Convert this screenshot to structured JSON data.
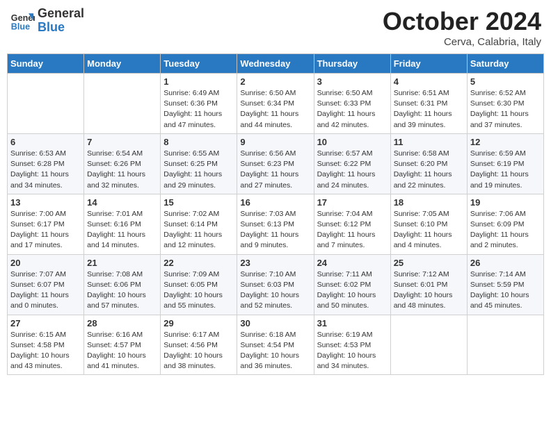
{
  "header": {
    "logo_line1": "General",
    "logo_line2": "Blue",
    "month_title": "October 2024",
    "location": "Cerva, Calabria, Italy"
  },
  "days_of_week": [
    "Sunday",
    "Monday",
    "Tuesday",
    "Wednesday",
    "Thursday",
    "Friday",
    "Saturday"
  ],
  "weeks": [
    [
      {
        "day": "",
        "info": ""
      },
      {
        "day": "",
        "info": ""
      },
      {
        "day": "1",
        "info": "Sunrise: 6:49 AM\nSunset: 6:36 PM\nDaylight: 11 hours and 47 minutes."
      },
      {
        "day": "2",
        "info": "Sunrise: 6:50 AM\nSunset: 6:34 PM\nDaylight: 11 hours and 44 minutes."
      },
      {
        "day": "3",
        "info": "Sunrise: 6:50 AM\nSunset: 6:33 PM\nDaylight: 11 hours and 42 minutes."
      },
      {
        "day": "4",
        "info": "Sunrise: 6:51 AM\nSunset: 6:31 PM\nDaylight: 11 hours and 39 minutes."
      },
      {
        "day": "5",
        "info": "Sunrise: 6:52 AM\nSunset: 6:30 PM\nDaylight: 11 hours and 37 minutes."
      }
    ],
    [
      {
        "day": "6",
        "info": "Sunrise: 6:53 AM\nSunset: 6:28 PM\nDaylight: 11 hours and 34 minutes."
      },
      {
        "day": "7",
        "info": "Sunrise: 6:54 AM\nSunset: 6:26 PM\nDaylight: 11 hours and 32 minutes."
      },
      {
        "day": "8",
        "info": "Sunrise: 6:55 AM\nSunset: 6:25 PM\nDaylight: 11 hours and 29 minutes."
      },
      {
        "day": "9",
        "info": "Sunrise: 6:56 AM\nSunset: 6:23 PM\nDaylight: 11 hours and 27 minutes."
      },
      {
        "day": "10",
        "info": "Sunrise: 6:57 AM\nSunset: 6:22 PM\nDaylight: 11 hours and 24 minutes."
      },
      {
        "day": "11",
        "info": "Sunrise: 6:58 AM\nSunset: 6:20 PM\nDaylight: 11 hours and 22 minutes."
      },
      {
        "day": "12",
        "info": "Sunrise: 6:59 AM\nSunset: 6:19 PM\nDaylight: 11 hours and 19 minutes."
      }
    ],
    [
      {
        "day": "13",
        "info": "Sunrise: 7:00 AM\nSunset: 6:17 PM\nDaylight: 11 hours and 17 minutes."
      },
      {
        "day": "14",
        "info": "Sunrise: 7:01 AM\nSunset: 6:16 PM\nDaylight: 11 hours and 14 minutes."
      },
      {
        "day": "15",
        "info": "Sunrise: 7:02 AM\nSunset: 6:14 PM\nDaylight: 11 hours and 12 minutes."
      },
      {
        "day": "16",
        "info": "Sunrise: 7:03 AM\nSunset: 6:13 PM\nDaylight: 11 hours and 9 minutes."
      },
      {
        "day": "17",
        "info": "Sunrise: 7:04 AM\nSunset: 6:12 PM\nDaylight: 11 hours and 7 minutes."
      },
      {
        "day": "18",
        "info": "Sunrise: 7:05 AM\nSunset: 6:10 PM\nDaylight: 11 hours and 4 minutes."
      },
      {
        "day": "19",
        "info": "Sunrise: 7:06 AM\nSunset: 6:09 PM\nDaylight: 11 hours and 2 minutes."
      }
    ],
    [
      {
        "day": "20",
        "info": "Sunrise: 7:07 AM\nSunset: 6:07 PM\nDaylight: 11 hours and 0 minutes."
      },
      {
        "day": "21",
        "info": "Sunrise: 7:08 AM\nSunset: 6:06 PM\nDaylight: 10 hours and 57 minutes."
      },
      {
        "day": "22",
        "info": "Sunrise: 7:09 AM\nSunset: 6:05 PM\nDaylight: 10 hours and 55 minutes."
      },
      {
        "day": "23",
        "info": "Sunrise: 7:10 AM\nSunset: 6:03 PM\nDaylight: 10 hours and 52 minutes."
      },
      {
        "day": "24",
        "info": "Sunrise: 7:11 AM\nSunset: 6:02 PM\nDaylight: 10 hours and 50 minutes."
      },
      {
        "day": "25",
        "info": "Sunrise: 7:12 AM\nSunset: 6:01 PM\nDaylight: 10 hours and 48 minutes."
      },
      {
        "day": "26",
        "info": "Sunrise: 7:14 AM\nSunset: 5:59 PM\nDaylight: 10 hours and 45 minutes."
      }
    ],
    [
      {
        "day": "27",
        "info": "Sunrise: 6:15 AM\nSunset: 4:58 PM\nDaylight: 10 hours and 43 minutes."
      },
      {
        "day": "28",
        "info": "Sunrise: 6:16 AM\nSunset: 4:57 PM\nDaylight: 10 hours and 41 minutes."
      },
      {
        "day": "29",
        "info": "Sunrise: 6:17 AM\nSunset: 4:56 PM\nDaylight: 10 hours and 38 minutes."
      },
      {
        "day": "30",
        "info": "Sunrise: 6:18 AM\nSunset: 4:54 PM\nDaylight: 10 hours and 36 minutes."
      },
      {
        "day": "31",
        "info": "Sunrise: 6:19 AM\nSunset: 4:53 PM\nDaylight: 10 hours and 34 minutes."
      },
      {
        "day": "",
        "info": ""
      },
      {
        "day": "",
        "info": ""
      }
    ]
  ]
}
